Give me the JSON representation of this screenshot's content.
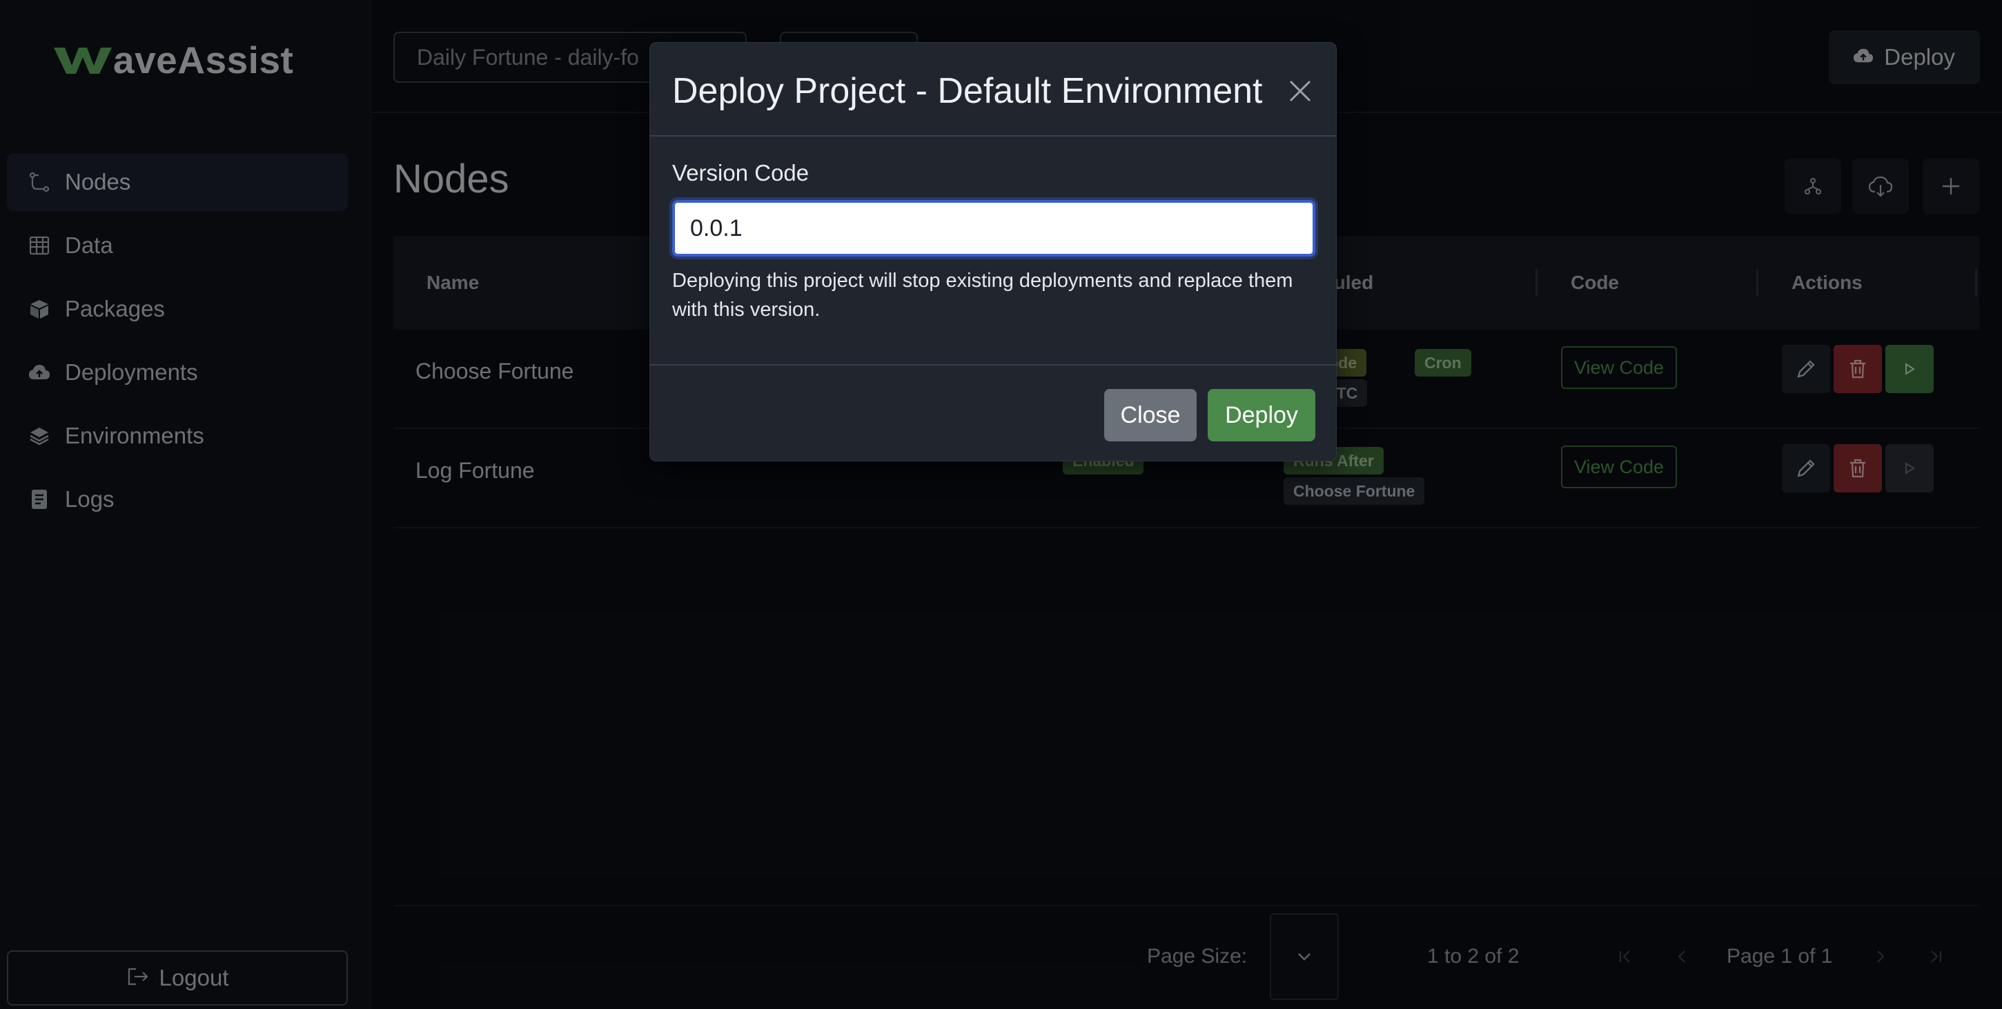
{
  "app": {
    "logo_mark": "W",
    "logo_rest": "aveAssist"
  },
  "sidebar": {
    "items": [
      {
        "label": "Nodes",
        "icon": "nodes-icon",
        "active": true
      },
      {
        "label": "Data",
        "icon": "table-icon",
        "active": false
      },
      {
        "label": "Packages",
        "icon": "package-icon",
        "active": false
      },
      {
        "label": "Deployments",
        "icon": "cloud-upload-icon",
        "active": false
      },
      {
        "label": "Environments",
        "icon": "layers-icon",
        "active": false
      },
      {
        "label": "Logs",
        "icon": "document-icon",
        "active": false
      }
    ],
    "logout_label": "Logout"
  },
  "header": {
    "project_select_value": "Daily Fortune - daily-fo",
    "deploy_label": "Deploy"
  },
  "main": {
    "title": "Nodes",
    "columns": [
      "Name",
      "eduled",
      "Code",
      "Actions"
    ],
    "rows": [
      {
        "name": "Choose Fortune",
        "badges": [
          "ng Node",
          "Cron"
        ],
        "schedule_text": "* * * UTC",
        "code_label": "View Code"
      },
      {
        "name": "Log Fortune",
        "status_badge": "Enabled",
        "badges": [
          "Runs After",
          "Choose Fortune"
        ],
        "code_label": "View Code"
      }
    ],
    "pager": {
      "page_size_label": "Page Size:",
      "range": "1 to 2 of 2",
      "page_info": "Page 1 of 1"
    }
  },
  "modal": {
    "title": "Deploy Project - Default Environment",
    "field_label": "Version Code",
    "field_value": "0.0.1",
    "help_text": "Deploying this project will stop existing deployments and replace them with this version.",
    "close_label": "Close",
    "deploy_label": "Deploy"
  },
  "colors": {
    "accent_green": "#4a8a4a",
    "danger_red": "#8e2c30",
    "focus_blue": "#3a5fd0"
  }
}
